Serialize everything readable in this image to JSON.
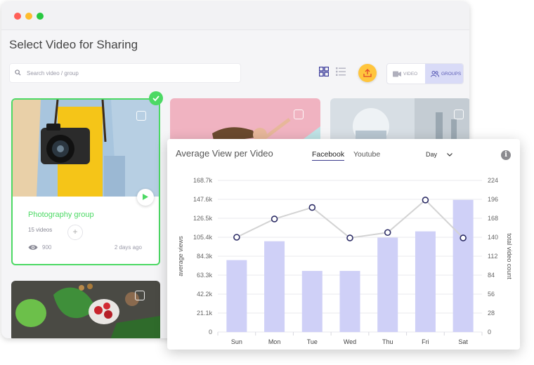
{
  "window": {
    "title": "Select Video for Sharing",
    "search": {
      "placeholder": "Search video / group",
      "icon": "search-icon"
    },
    "toolbar": {
      "grid_icon": "grid-view-icon",
      "list_icon": "list-view-icon",
      "upload_icon": "upload-icon",
      "toggle": {
        "video": "VIDEO",
        "groups": "GROUPS",
        "selected": "GROUPS"
      }
    },
    "cards": [
      {
        "name": "Photography group",
        "video_count": "15 videos",
        "views": "900",
        "ago": "2 days ago",
        "selected": true
      },
      {
        "name": "",
        "selected": false
      },
      {
        "name": "",
        "selected": false
      },
      {
        "name": "",
        "selected": false
      }
    ]
  },
  "chart_panel": {
    "title": "Average View per Video",
    "tabs": [
      {
        "label": "Facebook",
        "active": true
      },
      {
        "label": "Youtube",
        "active": false
      }
    ],
    "range": "Day",
    "info_icon": "info-icon"
  },
  "chart_data": {
    "type": "bar",
    "categories": [
      "Sun",
      "Mon",
      "Tue",
      "Wed",
      "Thu",
      "Fri",
      "Sat"
    ],
    "ylabel": "average views",
    "y2label": "total video count",
    "yticks": [
      "0",
      "21.1k",
      "42.2k",
      "63.3k",
      "84.3k",
      "105.4k",
      "126.5k",
      "147.6k",
      "168.7k"
    ],
    "y2ticks": [
      "0",
      "28",
      "56",
      "84",
      "112",
      "140",
      "168",
      "196",
      "224"
    ],
    "ylim": [
      0,
      168700
    ],
    "y2lim": [
      0,
      224
    ],
    "series": [
      {
        "type": "bar",
        "axis": "left",
        "color": "#cfd0f7",
        "values": [
          80000,
          101000,
          68000,
          68000,
          105000,
          112000,
          147000
        ]
      },
      {
        "type": "line",
        "axis": "right",
        "color": "#d3d3d3",
        "marker_color": "#2d2d66",
        "values": [
          140,
          167,
          184,
          139,
          147,
          195,
          139
        ]
      }
    ]
  }
}
